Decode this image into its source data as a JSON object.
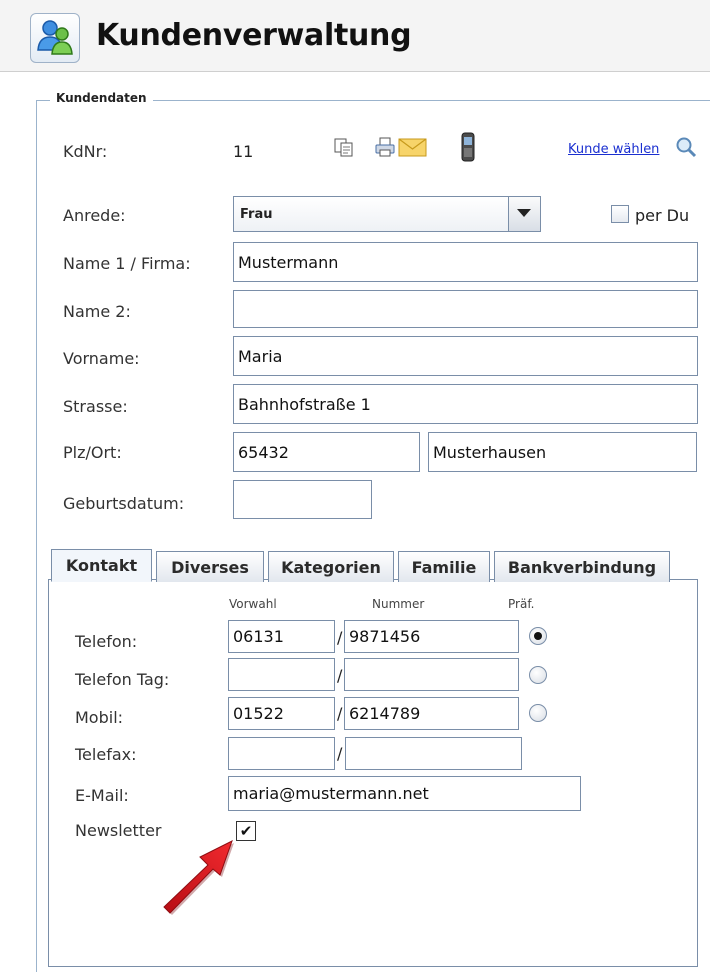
{
  "header": {
    "title": "Kundenverwaltung",
    "app_icon": "customers-icon"
  },
  "fieldset": {
    "legend": "Kundendaten"
  },
  "kdnr": {
    "label": "KdNr:",
    "value": "11",
    "toolbar_icons": [
      "copy-icon",
      "print-icon",
      "mail-icon",
      "phone-icon"
    ],
    "select_link": "Kunde wählen",
    "select_icon": "search-icon"
  },
  "anrede": {
    "label": "Anrede:",
    "value": "Frau",
    "per_du_label": "per Du",
    "per_du_checked": false
  },
  "form": {
    "name1": {
      "label": "Name 1 / Firma:",
      "value": "Mustermann"
    },
    "name2": {
      "label": "Name 2:",
      "value": ""
    },
    "vorname": {
      "label": "Vorname:",
      "value": "Maria"
    },
    "strasse": {
      "label": "Strasse:",
      "value": "Bahnhofstraße 1"
    },
    "plz_ort": {
      "label": "Plz/Ort:",
      "plz": "65432",
      "ort": "Musterhausen"
    },
    "geburtsdatum": {
      "label": "Geburtsdatum:",
      "value": ""
    }
  },
  "tabs": [
    {
      "label": "Kontakt",
      "active": true
    },
    {
      "label": "Diverses",
      "active": false
    },
    {
      "label": "Kategorien",
      "active": false
    },
    {
      "label": "Familie",
      "active": false
    },
    {
      "label": "Bankverbindung",
      "active": false
    }
  ],
  "kontakt": {
    "headers": {
      "vorwahl": "Vorwahl",
      "nummer": "Nummer",
      "pref": "Präf."
    },
    "separator": "/",
    "rows": [
      {
        "label": "Telefon:",
        "vorwahl": "06131",
        "nummer": "9871456",
        "preferred": true
      },
      {
        "label": "Telefon Tag:",
        "vorwahl": "",
        "nummer": "",
        "preferred": false
      },
      {
        "label": "Mobil:",
        "vorwahl": "01522",
        "nummer": "6214789",
        "preferred": false
      },
      {
        "label": "Telefax:",
        "vorwahl": "",
        "nummer": ""
      }
    ],
    "email": {
      "label": "E-Mail:",
      "value": "maria@mustermann.net"
    },
    "newsletter": {
      "label": "Newsletter",
      "checked": true,
      "checkmark": "✔"
    }
  },
  "annotation": {
    "arrow_color": "#e3141c"
  }
}
